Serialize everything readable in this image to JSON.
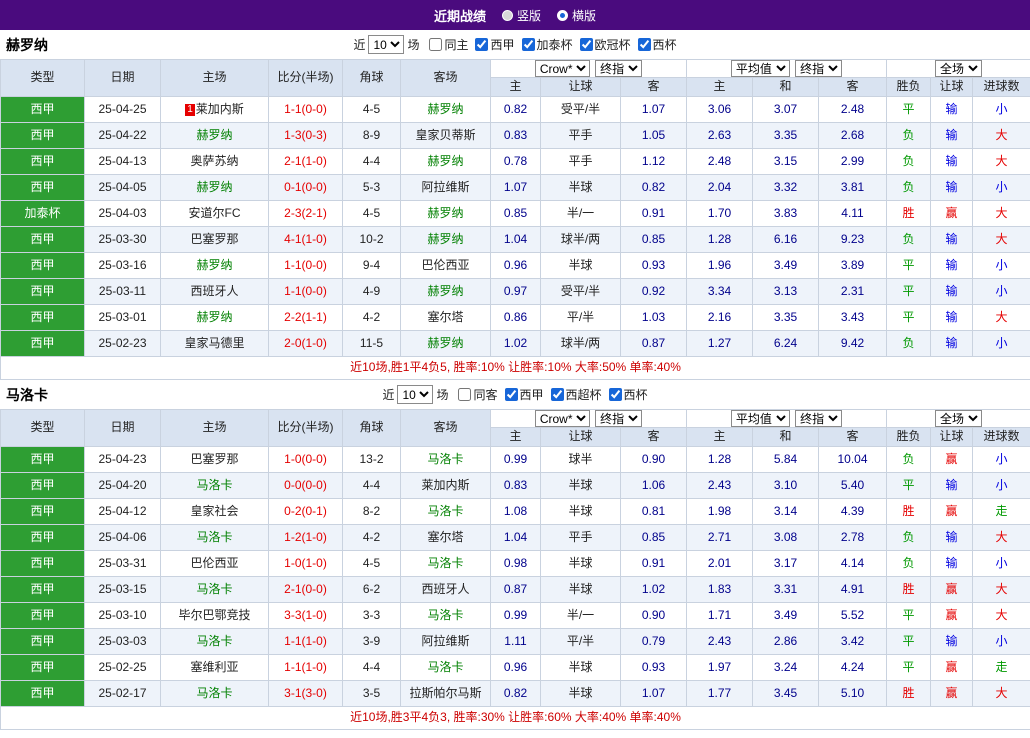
{
  "topbar": {
    "title": "近期战绩",
    "vertical": "竖版",
    "horizontal": "横版",
    "selected": "横版"
  },
  "controls": {
    "company": "Crow*",
    "stage": "终指",
    "average": "平均值",
    "stage2": "终指",
    "scope": "全场"
  },
  "columns": {
    "type": "类型",
    "date": "日期",
    "home": "主场",
    "score": "比分(半场)",
    "corner": "角球",
    "away": "客场",
    "crow_home": "主",
    "handicap": "让球",
    "crow_away": "客",
    "avg_home": "主",
    "avg_draw": "和",
    "avg_away": "客",
    "wdl": "胜负",
    "let_result": "让球",
    "goals": "进球数"
  },
  "colors": {
    "topbar_purple": "#4a0b7e",
    "league_green": "#2e9e33",
    "team_green": "#008000",
    "score_red": "#e50000",
    "odds_navy": "#00008b",
    "win_red": "#e50000",
    "draw_loss_green": "#009900",
    "lose_blue": "#0000e0",
    "header_blue": "#d9e3f1"
  },
  "sections": [
    {
      "team": "赫罗纳",
      "filter": {
        "near": "近",
        "count": "10",
        "games": "场",
        "same": {
          "label": "同主",
          "checked": false
        },
        "leagues": [
          {
            "label": "西甲",
            "checked": true
          },
          {
            "label": "加泰杯",
            "checked": true
          },
          {
            "label": "欧冠杯",
            "checked": true
          },
          {
            "label": "西杯",
            "checked": true
          }
        ]
      },
      "rows": [
        {
          "league": "西甲",
          "date": "25-04-25",
          "home": "莱加内斯",
          "home_badge": "1",
          "home_self": false,
          "score": "1-1(0-0)",
          "corner": "4-5",
          "away": "赫罗纳",
          "away_self": true,
          "crow": [
            "0.82",
            "受平/半",
            "1.07"
          ],
          "avg": [
            "3.06",
            "3.07",
            "2.48"
          ],
          "res": [
            [
              "平",
              "green"
            ],
            [
              "输",
              "blue"
            ],
            [
              "小",
              "blue"
            ]
          ]
        },
        {
          "league": "西甲",
          "date": "25-04-22",
          "home": "赫罗纳",
          "home_self": true,
          "score": "1-3(0-3)",
          "corner": "8-9",
          "away": "皇家贝蒂斯",
          "away_self": false,
          "crow": [
            "0.83",
            "平手",
            "1.05"
          ],
          "avg": [
            "2.63",
            "3.35",
            "2.68"
          ],
          "res": [
            [
              "负",
              "green"
            ],
            [
              "输",
              "blue"
            ],
            [
              "大",
              "red"
            ]
          ]
        },
        {
          "league": "西甲",
          "date": "25-04-13",
          "home": "奥萨苏纳",
          "home_self": false,
          "score": "2-1(1-0)",
          "corner": "4-4",
          "away": "赫罗纳",
          "away_self": true,
          "crow": [
            "0.78",
            "平手",
            "1.12"
          ],
          "avg": [
            "2.48",
            "3.15",
            "2.99"
          ],
          "res": [
            [
              "负",
              "green"
            ],
            [
              "输",
              "blue"
            ],
            [
              "大",
              "red"
            ]
          ]
        },
        {
          "league": "西甲",
          "date": "25-04-05",
          "home": "赫罗纳",
          "home_self": true,
          "score": "0-1(0-0)",
          "corner": "5-3",
          "away": "阿拉维斯",
          "away_self": false,
          "crow": [
            "1.07",
            "半球",
            "0.82"
          ],
          "avg": [
            "2.04",
            "3.32",
            "3.81"
          ],
          "res": [
            [
              "负",
              "green"
            ],
            [
              "输",
              "blue"
            ],
            [
              "小",
              "blue"
            ]
          ]
        },
        {
          "league": "加泰杯",
          "date": "25-04-03",
          "home": "安道尔FC",
          "home_self": false,
          "score": "2-3(2-1)",
          "corner": "4-5",
          "away": "赫罗纳",
          "away_self": true,
          "crow": [
            "0.85",
            "半/一",
            "0.91"
          ],
          "avg": [
            "1.70",
            "3.83",
            "4.11"
          ],
          "res": [
            [
              "胜",
              "red"
            ],
            [
              "赢",
              "red"
            ],
            [
              "大",
              "red"
            ]
          ]
        },
        {
          "league": "西甲",
          "date": "25-03-30",
          "home": "巴塞罗那",
          "home_self": false,
          "score": "4-1(1-0)",
          "corner": "10-2",
          "away": "赫罗纳",
          "away_self": true,
          "crow": [
            "1.04",
            "球半/两",
            "0.85"
          ],
          "avg": [
            "1.28",
            "6.16",
            "9.23"
          ],
          "res": [
            [
              "负",
              "green"
            ],
            [
              "输",
              "blue"
            ],
            [
              "大",
              "red"
            ]
          ]
        },
        {
          "league": "西甲",
          "date": "25-03-16",
          "home": "赫罗纳",
          "home_self": true,
          "score": "1-1(0-0)",
          "corner": "9-4",
          "away": "巴伦西亚",
          "away_self": false,
          "crow": [
            "0.96",
            "半球",
            "0.93"
          ],
          "avg": [
            "1.96",
            "3.49",
            "3.89"
          ],
          "res": [
            [
              "平",
              "green"
            ],
            [
              "输",
              "blue"
            ],
            [
              "小",
              "blue"
            ]
          ]
        },
        {
          "league": "西甲",
          "date": "25-03-11",
          "home": "西班牙人",
          "home_self": false,
          "score": "1-1(0-0)",
          "corner": "4-9",
          "away": "赫罗纳",
          "away_self": true,
          "crow": [
            "0.97",
            "受平/半",
            "0.92"
          ],
          "avg": [
            "3.34",
            "3.13",
            "2.31"
          ],
          "res": [
            [
              "平",
              "green"
            ],
            [
              "输",
              "blue"
            ],
            [
              "小",
              "blue"
            ]
          ]
        },
        {
          "league": "西甲",
          "date": "25-03-01",
          "home": "赫罗纳",
          "home_self": true,
          "score": "2-2(1-1)",
          "corner": "4-2",
          "away": "塞尔塔",
          "away_self": false,
          "crow": [
            "0.86",
            "平/半",
            "1.03"
          ],
          "avg": [
            "2.16",
            "3.35",
            "3.43"
          ],
          "res": [
            [
              "平",
              "green"
            ],
            [
              "输",
              "blue"
            ],
            [
              "大",
              "red"
            ]
          ]
        },
        {
          "league": "西甲",
          "date": "25-02-23",
          "home": "皇家马德里",
          "home_self": false,
          "score": "2-0(1-0)",
          "corner": "11-5",
          "away": "赫罗纳",
          "away_self": true,
          "crow": [
            "1.02",
            "球半/两",
            "0.87"
          ],
          "avg": [
            "1.27",
            "6.24",
            "9.42"
          ],
          "res": [
            [
              "负",
              "green"
            ],
            [
              "输",
              "blue"
            ],
            [
              "小",
              "blue"
            ]
          ]
        }
      ],
      "summary": "近10场,胜1平4负5, 胜率:10% 让胜率:10% 大率:50% 单率:40%"
    },
    {
      "team": "马洛卡",
      "filter": {
        "near": "近",
        "count": "10",
        "games": "场",
        "same": {
          "label": "同客",
          "checked": false
        },
        "leagues": [
          {
            "label": "西甲",
            "checked": true
          },
          {
            "label": "西超杯",
            "checked": true
          },
          {
            "label": "西杯",
            "checked": true
          }
        ]
      },
      "rows": [
        {
          "league": "西甲",
          "date": "25-04-23",
          "home": "巴塞罗那",
          "home_self": false,
          "score": "1-0(0-0)",
          "corner": "13-2",
          "away": "马洛卡",
          "away_self": true,
          "crow": [
            "0.99",
            "球半",
            "0.90"
          ],
          "avg": [
            "1.28",
            "5.84",
            "10.04"
          ],
          "res": [
            [
              "负",
              "green"
            ],
            [
              "赢",
              "red"
            ],
            [
              "小",
              "blue"
            ]
          ]
        },
        {
          "league": "西甲",
          "date": "25-04-20",
          "home": "马洛卡",
          "home_self": true,
          "score": "0-0(0-0)",
          "corner": "4-4",
          "away": "莱加内斯",
          "away_self": false,
          "crow": [
            "0.83",
            "半球",
            "1.06"
          ],
          "avg": [
            "2.43",
            "3.10",
            "5.40"
          ],
          "res": [
            [
              "平",
              "green"
            ],
            [
              "输",
              "blue"
            ],
            [
              "小",
              "blue"
            ]
          ]
        },
        {
          "league": "西甲",
          "date": "25-04-12",
          "home": "皇家社会",
          "home_self": false,
          "score": "0-2(0-1)",
          "corner": "8-2",
          "away": "马洛卡",
          "away_self": true,
          "crow": [
            "1.08",
            "半球",
            "0.81"
          ],
          "avg": [
            "1.98",
            "3.14",
            "4.39"
          ],
          "res": [
            [
              "胜",
              "red"
            ],
            [
              "赢",
              "red"
            ],
            [
              "走",
              "green"
            ]
          ]
        },
        {
          "league": "西甲",
          "date": "25-04-06",
          "home": "马洛卡",
          "home_self": true,
          "score": "1-2(1-0)",
          "corner": "4-2",
          "away": "塞尔塔",
          "away_self": false,
          "crow": [
            "1.04",
            "平手",
            "0.85"
          ],
          "avg": [
            "2.71",
            "3.08",
            "2.78"
          ],
          "res": [
            [
              "负",
              "green"
            ],
            [
              "输",
              "blue"
            ],
            [
              "大",
              "red"
            ]
          ]
        },
        {
          "league": "西甲",
          "date": "25-03-31",
          "home": "巴伦西亚",
          "home_self": false,
          "score": "1-0(1-0)",
          "corner": "4-5",
          "away": "马洛卡",
          "away_self": true,
          "crow": [
            "0.98",
            "半球",
            "0.91"
          ],
          "avg": [
            "2.01",
            "3.17",
            "4.14"
          ],
          "res": [
            [
              "负",
              "green"
            ],
            [
              "输",
              "blue"
            ],
            [
              "小",
              "blue"
            ]
          ]
        },
        {
          "league": "西甲",
          "date": "25-03-15",
          "home": "马洛卡",
          "home_self": true,
          "score": "2-1(0-0)",
          "corner": "6-2",
          "away": "西班牙人",
          "away_self": false,
          "crow": [
            "0.87",
            "半球",
            "1.02"
          ],
          "avg": [
            "1.83",
            "3.31",
            "4.91"
          ],
          "res": [
            [
              "胜",
              "red"
            ],
            [
              "赢",
              "red"
            ],
            [
              "大",
              "red"
            ]
          ]
        },
        {
          "league": "西甲",
          "date": "25-03-10",
          "home": "毕尔巴鄂竞技",
          "home_self": false,
          "score": "3-3(1-0)",
          "corner": "3-3",
          "away": "马洛卡",
          "away_self": true,
          "crow": [
            "0.99",
            "半/一",
            "0.90"
          ],
          "avg": [
            "1.71",
            "3.49",
            "5.52"
          ],
          "res": [
            [
              "平",
              "green"
            ],
            [
              "赢",
              "red"
            ],
            [
              "大",
              "red"
            ]
          ]
        },
        {
          "league": "西甲",
          "date": "25-03-03",
          "home": "马洛卡",
          "home_self": true,
          "score": "1-1(1-0)",
          "corner": "3-9",
          "away": "阿拉维斯",
          "away_self": false,
          "crow": [
            "1.11",
            "平/半",
            "0.79"
          ],
          "avg": [
            "2.43",
            "2.86",
            "3.42"
          ],
          "res": [
            [
              "平",
              "green"
            ],
            [
              "输",
              "blue"
            ],
            [
              "小",
              "blue"
            ]
          ]
        },
        {
          "league": "西甲",
          "date": "25-02-25",
          "home": "塞维利亚",
          "home_self": false,
          "score": "1-1(1-0)",
          "corner": "4-4",
          "away": "马洛卡",
          "away_self": true,
          "crow": [
            "0.96",
            "半球",
            "0.93"
          ],
          "avg": [
            "1.97",
            "3.24",
            "4.24"
          ],
          "res": [
            [
              "平",
              "green"
            ],
            [
              "赢",
              "red"
            ],
            [
              "走",
              "green"
            ]
          ]
        },
        {
          "league": "西甲",
          "date": "25-02-17",
          "home": "马洛卡",
          "home_self": true,
          "score": "3-1(3-0)",
          "corner": "3-5",
          "away": "拉斯帕尔马斯",
          "away_self": false,
          "crow": [
            "0.82",
            "半球",
            "1.07"
          ],
          "avg": [
            "1.77",
            "3.45",
            "5.10"
          ],
          "res": [
            [
              "胜",
              "red"
            ],
            [
              "赢",
              "red"
            ],
            [
              "大",
              "red"
            ]
          ]
        }
      ],
      "summary": "近10场,胜3平4负3, 胜率:30% 让胜率:60% 大率:40% 单率:40%"
    }
  ]
}
